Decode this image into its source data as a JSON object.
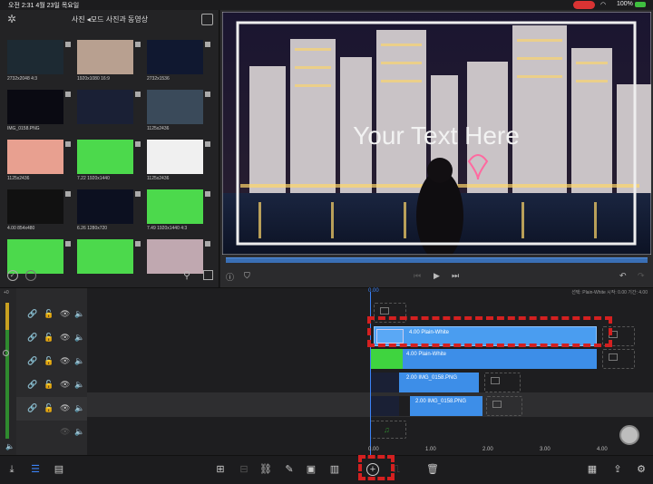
{
  "status": {
    "time": "오전 2:31   4월 23일 목요일",
    "battery": "100%",
    "wifi": "◠"
  },
  "browser": {
    "title": "사진 ◂모드 사진과 동영상",
    "items": [
      {
        "meta": "2732x2048  4:3",
        "color": "#1d2a33"
      },
      {
        "meta": "1920x1080  16:9",
        "color": "#b8a090"
      },
      {
        "meta": "2732x1536",
        "color": "#101830"
      },
      {
        "meta": "IMG_0158.PNG",
        "color": "#0a0a12"
      },
      {
        "meta": "",
        "color": "#1a2035"
      },
      {
        "meta": "1125x2436",
        "color": "#3a4a5a"
      },
      {
        "meta": "1125x2436",
        "color": "#e8a090"
      },
      {
        "meta": "7.22  1920x1440",
        "color": "#4cd94c"
      },
      {
        "meta": "1125x2436",
        "color": "#f0f0f0"
      },
      {
        "meta": "4.00  854x480",
        "color": "#111"
      },
      {
        "meta": "6.26  1280x720",
        "color": "#0c1020"
      },
      {
        "meta": "7.49  1920x1440  4:3",
        "color": "#4cd94c"
      },
      {
        "meta": "",
        "color": "#4cd94c"
      },
      {
        "meta": "",
        "color": "#4cd94c"
      },
      {
        "meta": "",
        "color": "#c0a8b0"
      }
    ]
  },
  "preview": {
    "overlay_text": "Your Text Here"
  },
  "timeline": {
    "info": "선택: Plain-White 시작: 0.00 기간: 4.00",
    "playhead_label": "0.00",
    "ruler": [
      "0.00",
      "1.00",
      "2.00",
      "3.00",
      "4.00"
    ],
    "clips": {
      "text_clip": "4.00  Plain-White",
      "green_clip": "4.00  Plain-White",
      "img1": "2.00  IMG_0158.PNG",
      "img2": "2.00  IMG_0158.PNG"
    },
    "level_marker": "+0"
  },
  "colors": {
    "accent": "#3b82f6",
    "clip_blue": "#3d8ee8",
    "highlight": "#d42020",
    "green": "#3fd43f"
  }
}
